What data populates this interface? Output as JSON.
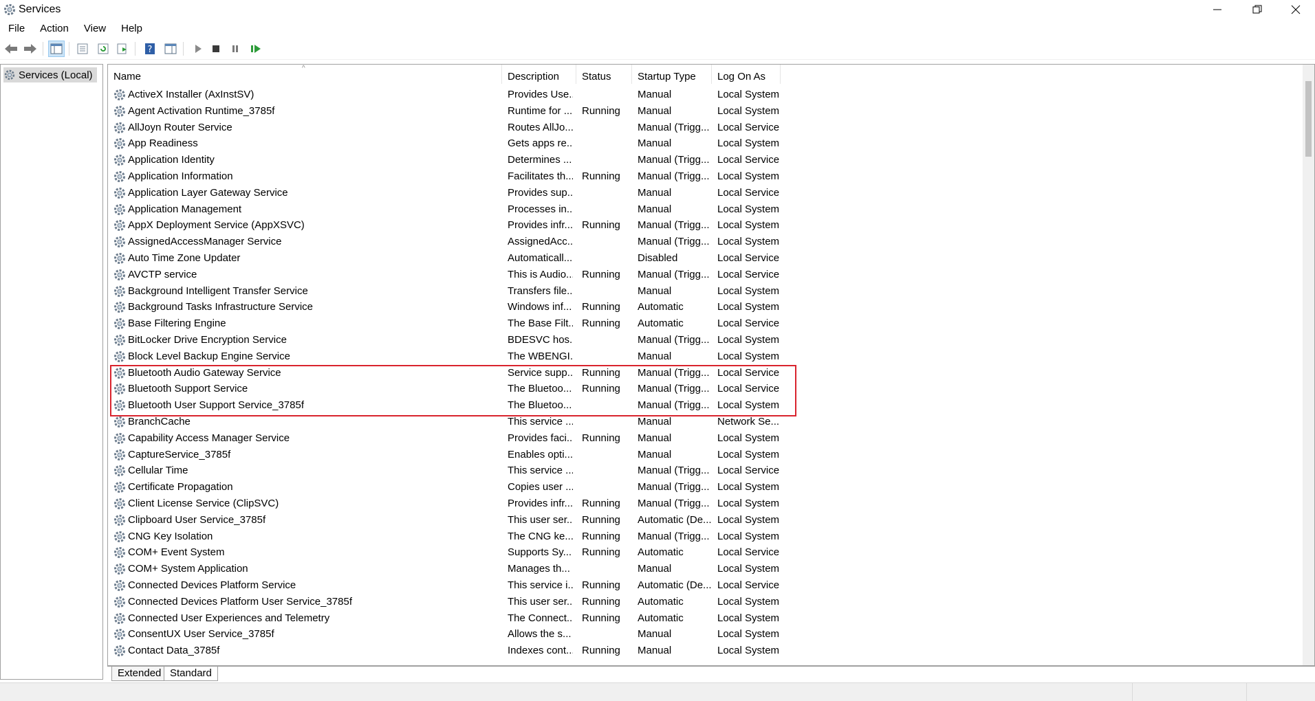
{
  "window": {
    "title": "Services"
  },
  "menu": [
    "File",
    "Action",
    "View",
    "Help"
  ],
  "tree": {
    "root_label": "Services (Local)"
  },
  "columns": {
    "name": "Name",
    "description": "Description",
    "status": "Status",
    "startup": "Startup Type",
    "logon": "Log On As"
  },
  "services": [
    {
      "name": "ActiveX Installer (AxInstSV)",
      "description": "Provides Use...",
      "status": "",
      "startup": "Manual",
      "logon": "Local System"
    },
    {
      "name": "Agent Activation Runtime_3785f",
      "description": "Runtime for ...",
      "status": "Running",
      "startup": "Manual",
      "logon": "Local System"
    },
    {
      "name": "AllJoyn Router Service",
      "description": "Routes AllJo...",
      "status": "",
      "startup": "Manual (Trigg...",
      "logon": "Local Service"
    },
    {
      "name": "App Readiness",
      "description": "Gets apps re...",
      "status": "",
      "startup": "Manual",
      "logon": "Local System"
    },
    {
      "name": "Application Identity",
      "description": "Determines ...",
      "status": "",
      "startup": "Manual (Trigg...",
      "logon": "Local Service"
    },
    {
      "name": "Application Information",
      "description": "Facilitates th...",
      "status": "Running",
      "startup": "Manual (Trigg...",
      "logon": "Local System"
    },
    {
      "name": "Application Layer Gateway Service",
      "description": "Provides sup...",
      "status": "",
      "startup": "Manual",
      "logon": "Local Service"
    },
    {
      "name": "Application Management",
      "description": "Processes in...",
      "status": "",
      "startup": "Manual",
      "logon": "Local System"
    },
    {
      "name": "AppX Deployment Service (AppXSVC)",
      "description": "Provides infr...",
      "status": "Running",
      "startup": "Manual (Trigg...",
      "logon": "Local System"
    },
    {
      "name": "AssignedAccessManager Service",
      "description": "AssignedAcc...",
      "status": "",
      "startup": "Manual (Trigg...",
      "logon": "Local System"
    },
    {
      "name": "Auto Time Zone Updater",
      "description": "Automaticall...",
      "status": "",
      "startup": "Disabled",
      "logon": "Local Service"
    },
    {
      "name": "AVCTP service",
      "description": "This is Audio...",
      "status": "Running",
      "startup": "Manual (Trigg...",
      "logon": "Local Service"
    },
    {
      "name": "Background Intelligent Transfer Service",
      "description": "Transfers file...",
      "status": "",
      "startup": "Manual",
      "logon": "Local System"
    },
    {
      "name": "Background Tasks Infrastructure Service",
      "description": "Windows inf...",
      "status": "Running",
      "startup": "Automatic",
      "logon": "Local System"
    },
    {
      "name": "Base Filtering Engine",
      "description": "The Base Filt...",
      "status": "Running",
      "startup": "Automatic",
      "logon": "Local Service"
    },
    {
      "name": "BitLocker Drive Encryption Service",
      "description": "BDESVC hos...",
      "status": "",
      "startup": "Manual (Trigg...",
      "logon": "Local System"
    },
    {
      "name": "Block Level Backup Engine Service",
      "description": "The WBENGI...",
      "status": "",
      "startup": "Manual",
      "logon": "Local System"
    },
    {
      "name": "Bluetooth Audio Gateway Service",
      "description": "Service supp...",
      "status": "Running",
      "startup": "Manual (Trigg...",
      "logon": "Local Service"
    },
    {
      "name": "Bluetooth Support Service",
      "description": "The Bluetoo...",
      "status": "Running",
      "startup": "Manual (Trigg...",
      "logon": "Local Service"
    },
    {
      "name": "Bluetooth User Support Service_3785f",
      "description": "The Bluetoo...",
      "status": "",
      "startup": "Manual (Trigg...",
      "logon": "Local System"
    },
    {
      "name": "BranchCache",
      "description": "This service ...",
      "status": "",
      "startup": "Manual",
      "logon": "Network Se..."
    },
    {
      "name": "Capability Access Manager Service",
      "description": "Provides faci...",
      "status": "Running",
      "startup": "Manual",
      "logon": "Local System"
    },
    {
      "name": "CaptureService_3785f",
      "description": "Enables opti...",
      "status": "",
      "startup": "Manual",
      "logon": "Local System"
    },
    {
      "name": "Cellular Time",
      "description": "This service ...",
      "status": "",
      "startup": "Manual (Trigg...",
      "logon": "Local Service"
    },
    {
      "name": "Certificate Propagation",
      "description": "Copies user ...",
      "status": "",
      "startup": "Manual (Trigg...",
      "logon": "Local System"
    },
    {
      "name": "Client License Service (ClipSVC)",
      "description": "Provides infr...",
      "status": "Running",
      "startup": "Manual (Trigg...",
      "logon": "Local System"
    },
    {
      "name": "Clipboard User Service_3785f",
      "description": "This user ser...",
      "status": "Running",
      "startup": "Automatic (De...",
      "logon": "Local System"
    },
    {
      "name": "CNG Key Isolation",
      "description": "The CNG ke...",
      "status": "Running",
      "startup": "Manual (Trigg...",
      "logon": "Local System"
    },
    {
      "name": "COM+ Event System",
      "description": "Supports Sy...",
      "status": "Running",
      "startup": "Automatic",
      "logon": "Local Service"
    },
    {
      "name": "COM+ System Application",
      "description": "Manages th...",
      "status": "",
      "startup": "Manual",
      "logon": "Local System"
    },
    {
      "name": "Connected Devices Platform Service",
      "description": "This service i...",
      "status": "Running",
      "startup": "Automatic (De...",
      "logon": "Local Service"
    },
    {
      "name": "Connected Devices Platform User Service_3785f",
      "description": "This user ser...",
      "status": "Running",
      "startup": "Automatic",
      "logon": "Local System"
    },
    {
      "name": "Connected User Experiences and Telemetry",
      "description": "The Connect...",
      "status": "Running",
      "startup": "Automatic",
      "logon": "Local System"
    },
    {
      "name": "ConsentUX User Service_3785f",
      "description": "Allows the s...",
      "status": "",
      "startup": "Manual",
      "logon": "Local System"
    },
    {
      "name": "Contact Data_3785f",
      "description": "Indexes cont...",
      "status": "Running",
      "startup": "Manual",
      "logon": "Local System"
    }
  ],
  "tabs": [
    "Extended",
    "Standard"
  ],
  "colors": {
    "highlight_border": "#d9232d",
    "selection_bg": "#d9d9d9"
  }
}
